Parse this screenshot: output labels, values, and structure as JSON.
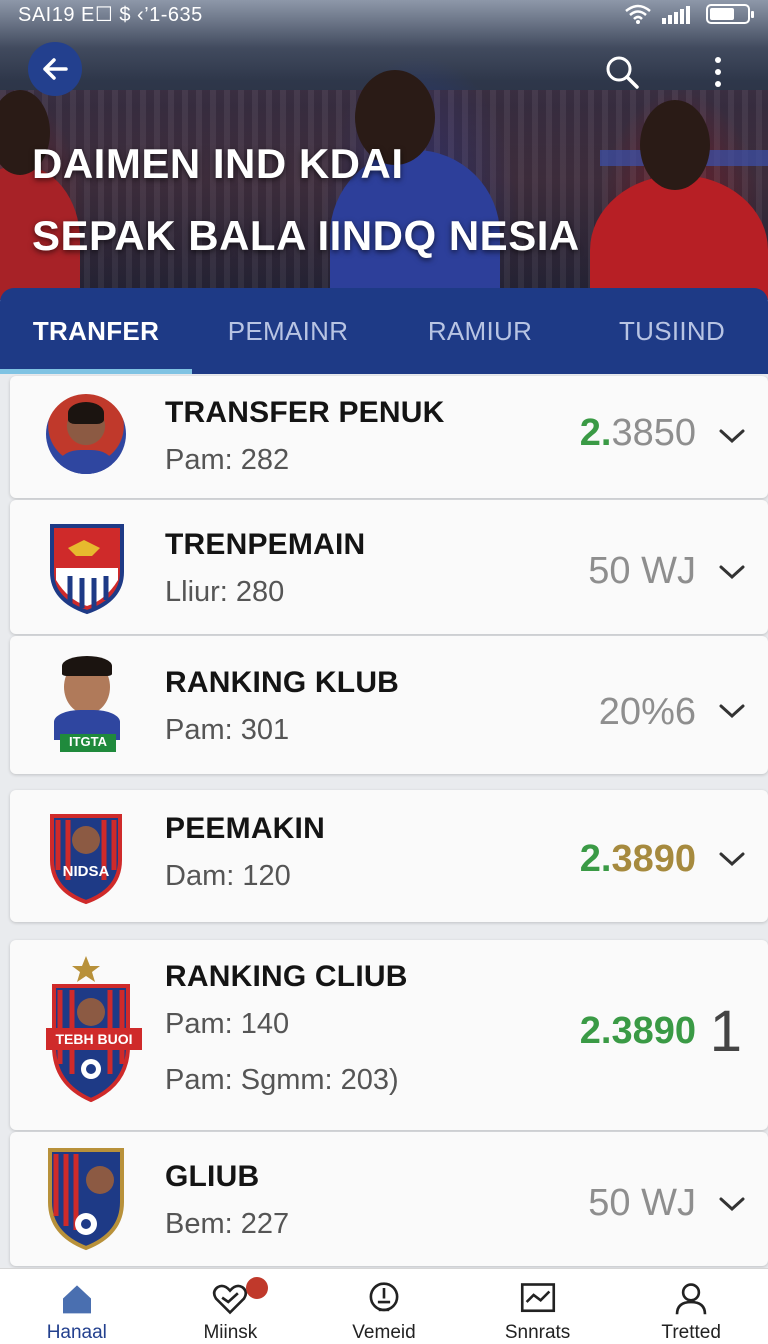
{
  "status_bar": {
    "left_text": "SAI19 E☐ $ ‹’1-635",
    "signal_icon": "signal-icon",
    "wifi_icon": "wifi-icon",
    "battery_icon": "battery-icon"
  },
  "header": {
    "title_line1": "DAIMEN IND KDAI",
    "title_line2": "SEPAK BALA IINDQ NESIA",
    "back_icon": "arrow-left-icon",
    "search_icon": "search-icon",
    "more_icon": "more-vertical-icon"
  },
  "tabs": [
    {
      "label": "TRANFER",
      "active": true
    },
    {
      "label": "PEMAINR",
      "active": false
    },
    {
      "label": "RAMIUR",
      "active": false
    },
    {
      "label": "TUSIIND",
      "active": false
    }
  ],
  "list": [
    {
      "name": "TRANSFER PENUK",
      "sub": "Pam: 282",
      "value_prefix": "2.",
      "value_rest": "3850",
      "value_style": "green-prefix",
      "icon": "player-avatar"
    },
    {
      "name": "TRENPEMAIN",
      "sub": "Lliur: 280",
      "value": "50 WJ",
      "value_style": "gray",
      "icon": "club-crest-icon"
    },
    {
      "name": "RANKING KLUB",
      "sub": "Pam: 301",
      "value": "20%6",
      "value_style": "gray",
      "icon": "player-portrait"
    },
    {
      "name": "PEEMAKIN",
      "sub": "Dam: 120",
      "value_prefix": "2.",
      "value_rest": "3890",
      "value_style": "green-gold",
      "icon": "club-crest-icon",
      "crest_text": "NIDSA"
    },
    {
      "name": "RANKING CLIUB",
      "sub": "Pam:  140",
      "sub2": "Pam: Sgmm: 203)",
      "value": "2.3890",
      "value_style": "green",
      "trailing": "1",
      "icon": "club-crest-icon",
      "crest_text": "TEBH BUOI"
    },
    {
      "name": "GLIUB",
      "sub": "Bem: 227",
      "value": "50 WJ",
      "value_style": "gray",
      "icon": "club-crest-icon"
    }
  ],
  "crest_badge_text": "ITGTA",
  "bottom_nav": [
    {
      "label": "Hanaal",
      "icon": "home-icon",
      "active": true
    },
    {
      "label": "Miinsk",
      "icon": "heart-shield-icon",
      "active": false
    },
    {
      "label": "Vemeid",
      "icon": "trophy-icon",
      "active": false
    },
    {
      "label": "Snnrats",
      "icon": "chart-icon",
      "active": false
    },
    {
      "label": "Tretted",
      "icon": "profile-icon",
      "active": false
    }
  ],
  "colors": {
    "primary": "#1e3a86",
    "accent_green": "#3a9a45",
    "accent_gold": "#a68a3e",
    "tab_indicator": "#7fc3e3"
  }
}
